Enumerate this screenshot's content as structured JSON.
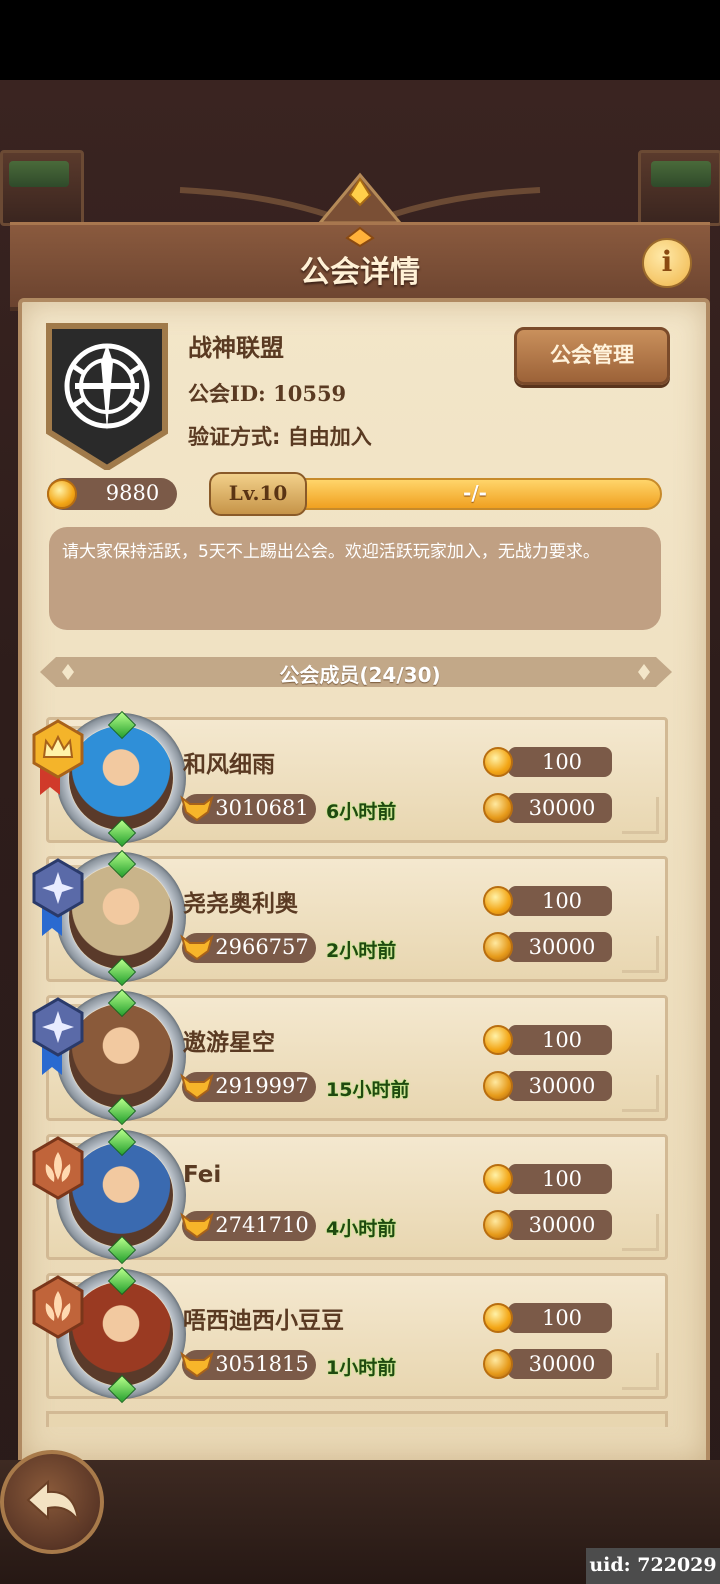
{
  "header": {
    "title": "公会详情",
    "info_icon": "info-icon"
  },
  "guild": {
    "name": "战神联盟",
    "id_label": "公会ID: ",
    "id_value": "10559",
    "verify_label": "验证方式: 自由加入",
    "manage_button": "公会管理",
    "coins": "9880",
    "level": "Lv.10",
    "exp_text": "-/-",
    "notice": "请大家保持活跃，5天不上踢出公会。欢迎活跃玩家加入，无战力要求。"
  },
  "members_header": "公会成员(24/30)",
  "members": [
    {
      "name": "和风细雨",
      "power": "3010681",
      "last_online": "6小时前",
      "stat1": "100",
      "stat2": "30000",
      "rank": "gold-crown",
      "accent": "#2f8fd8"
    },
    {
      "name": "尧尧奥利奥",
      "power": "2966757",
      "last_online": "2小时前",
      "stat1": "100",
      "stat2": "30000",
      "rank": "blue-star",
      "accent": "#c9b48a"
    },
    {
      "name": "遨游星空",
      "power": "2919997",
      "last_online": "15小时前",
      "stat1": "100",
      "stat2": "30000",
      "rank": "blue-star",
      "accent": "#8a5a3a"
    },
    {
      "name": "Fei",
      "power": "2741710",
      "last_online": "4小时前",
      "stat1": "100",
      "stat2": "30000",
      "rank": "bronze-leaf",
      "accent": "#3a6ab0"
    },
    {
      "name": "唔西迪西小豆豆",
      "power": "3051815",
      "last_online": "1小时前",
      "stat1": "100",
      "stat2": "30000",
      "rank": "bronze-leaf",
      "accent": "#9a3a22"
    }
  ],
  "footer": {
    "uid": "uid: 722029",
    "back_icon": "back-arrow-icon"
  },
  "colors": {
    "panel": "#f3e6c9",
    "text_brown": "#5a3a22",
    "pill": "#7b5a48",
    "gold": "#f0a020"
  }
}
